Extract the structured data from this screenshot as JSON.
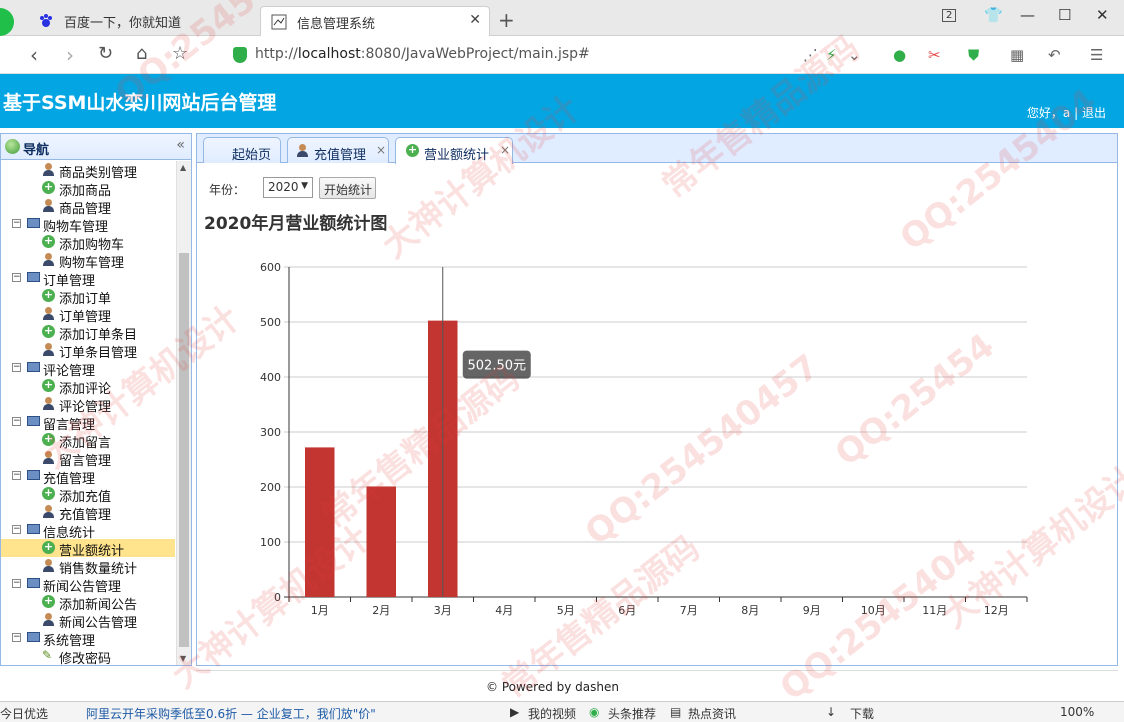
{
  "browser": {
    "tabs": [
      {
        "label": "百度一下，你就知道",
        "icon": "baidu-paw-icon"
      },
      {
        "label": "信息管理系统",
        "icon": "page-icon"
      }
    ],
    "window_count": "2",
    "url_host": "localhost",
    "url_prefix": "http://",
    "url_rest": ":8080/JavaWebProject/main.jsp#"
  },
  "app": {
    "title": "基于SSM山水栾川网站后台管理",
    "greeting": "您好，a",
    "sep": "|",
    "logout": "退出"
  },
  "nav": {
    "title": "导航",
    "items": [
      {
        "label": "商品类别管理",
        "type": "leaf",
        "icon": "user-icon"
      },
      {
        "label": "添加商品",
        "type": "leaf",
        "icon": "add-icon"
      },
      {
        "label": "商品管理",
        "type": "leaf",
        "icon": "user-icon"
      },
      {
        "label": "购物车管理",
        "type": "group"
      },
      {
        "label": "添加购物车",
        "type": "leaf",
        "icon": "add-icon"
      },
      {
        "label": "购物车管理",
        "type": "leaf",
        "icon": "user-icon"
      },
      {
        "label": "订单管理",
        "type": "group"
      },
      {
        "label": "添加订单",
        "type": "leaf",
        "icon": "add-icon"
      },
      {
        "label": "订单管理",
        "type": "leaf",
        "icon": "user-icon"
      },
      {
        "label": "添加订单条目",
        "type": "leaf",
        "icon": "add-icon"
      },
      {
        "label": "订单条目管理",
        "type": "leaf",
        "icon": "user-icon"
      },
      {
        "label": "评论管理",
        "type": "group"
      },
      {
        "label": "添加评论",
        "type": "leaf",
        "icon": "add-icon"
      },
      {
        "label": "评论管理",
        "type": "leaf",
        "icon": "user-icon"
      },
      {
        "label": "留言管理",
        "type": "group"
      },
      {
        "label": "添加留言",
        "type": "leaf",
        "icon": "add-icon"
      },
      {
        "label": "留言管理",
        "type": "leaf",
        "icon": "user-icon"
      },
      {
        "label": "充值管理",
        "type": "group"
      },
      {
        "label": "添加充值",
        "type": "leaf",
        "icon": "add-icon"
      },
      {
        "label": "充值管理",
        "type": "leaf",
        "icon": "user-icon"
      },
      {
        "label": "信息统计",
        "type": "group"
      },
      {
        "label": "营业额统计",
        "type": "leaf",
        "icon": "add-icon",
        "selected": true
      },
      {
        "label": "销售数量统计",
        "type": "leaf",
        "icon": "user-icon"
      },
      {
        "label": "新闻公告管理",
        "type": "group"
      },
      {
        "label": "添加新闻公告",
        "type": "leaf",
        "icon": "add-icon"
      },
      {
        "label": "新闻公告管理",
        "type": "leaf",
        "icon": "user-icon"
      },
      {
        "label": "系统管理",
        "type": "group"
      },
      {
        "label": "修改密码",
        "type": "leaf",
        "icon": "pencil-icon"
      }
    ]
  },
  "content_tabs": [
    {
      "label": "起始页",
      "closable": false
    },
    {
      "label": "充值管理",
      "closable": true
    },
    {
      "label": "营业额统计",
      "closable": true,
      "active": true
    }
  ],
  "filter": {
    "year_label": "年份：",
    "year_value": "2020",
    "start_button": "开始统计"
  },
  "chart_data": {
    "type": "bar",
    "title": "2020年月营业额统计图",
    "categories": [
      "1月",
      "2月",
      "3月",
      "4月",
      "5月",
      "6月",
      "7月",
      "8月",
      "9月",
      "10月",
      "11月",
      "12月"
    ],
    "values": [
      272,
      201,
      502.5,
      0,
      0,
      0,
      0,
      0,
      0,
      0,
      0,
      0
    ],
    "ylim": [
      0,
      600
    ],
    "yticks": [
      0,
      100,
      200,
      300,
      400,
      500,
      600
    ],
    "bar_color": "#c23531",
    "tooltip": {
      "category": "3月",
      "text": "502.50元"
    },
    "grid": true
  },
  "footer": "© Powered by dashen",
  "statusbar": {
    "left": "今日优选",
    "news": "阿里云开年采购季低至0.6折 — 企业复工，我们放\"价\"",
    "video": "我的视频",
    "headline": "头条推荐",
    "hot": "热点资讯",
    "download": "下载",
    "zoom": "100%"
  },
  "watermark": [
    "QQ:25454",
    "大神计算机设计",
    "常年售精品源码",
    "QQ:2545404",
    "大神计算机设计",
    "常年售精品源码",
    "QQ:254540457"
  ]
}
